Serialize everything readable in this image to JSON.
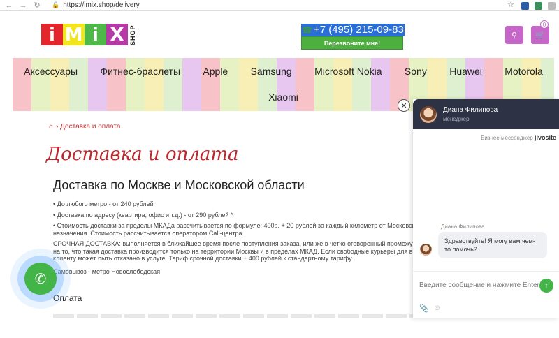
{
  "browser": {
    "back_icon": "arrow-left-icon",
    "forward_icon": "arrow-right-icon",
    "reload_icon": "reload-icon",
    "url": "https://imix.shop/delivery"
  },
  "header": {
    "logo_letters": [
      "i",
      "M",
      "i",
      "X"
    ],
    "logo_colors": [
      "#e3262c",
      "#f3e51c",
      "#4eb848",
      "#b53aa6"
    ],
    "logo_suffix": "SHOP",
    "phone": "+7 (495) 215-09-83",
    "callback_label": "Перезвоните мне!",
    "cart_count": "0"
  },
  "menu": {
    "row1": [
      "Аксессуары",
      "Фитнес-браслеты",
      "Apple",
      "Samsung",
      "Microsoft Nokia",
      "Sony",
      "Huawei",
      "Motorola"
    ],
    "row2": [
      "Xiaomi"
    ]
  },
  "breadcrumb": {
    "current": "Доставка и оплата"
  },
  "page": {
    "title": "Доставка и оплата",
    "section_title": "Доставка по Москве и Московской области",
    "paragraphs": [
      "• До любого метро - от 240 рублей",
      "• Доставка по адресу (квартира, офис и т.д.) - от 290 рублей *",
      "• Стоимость доставки за пределы МКАДа рассчитывается по формуле: 400р. + 20 рублей за каждый километр от Московск",
      "назначения. Стоимость рассчитывается оператором Call-центра.",
      "СРОЧНАЯ ДОСТАВКА: выполняется в ближайшее время после поступления заказа, или же в четко оговоренный промежут",
      "на то, что такая доставка производится только на территории Москвы и в пределах МКАД. Если свободные курьеры для вы",
      "клиенту может быть отказано в услуге. Тариф срочной доставки + 400 рублей к стандартному тарифу.",
      "Самовывоз - метро Новослободская"
    ],
    "payment_title": "Оплата"
  },
  "chat": {
    "operator_name": "Диана Филипова",
    "operator_role": "менеджер",
    "brand_text": "Бизнес-мессенджер",
    "brand_name": "jivosite",
    "message_author": "Диана Филипова",
    "message": "Здравствуйте! Я могу вам чем-то помочь?",
    "input_placeholder": "Введите сообщение и нажмите Enter"
  }
}
